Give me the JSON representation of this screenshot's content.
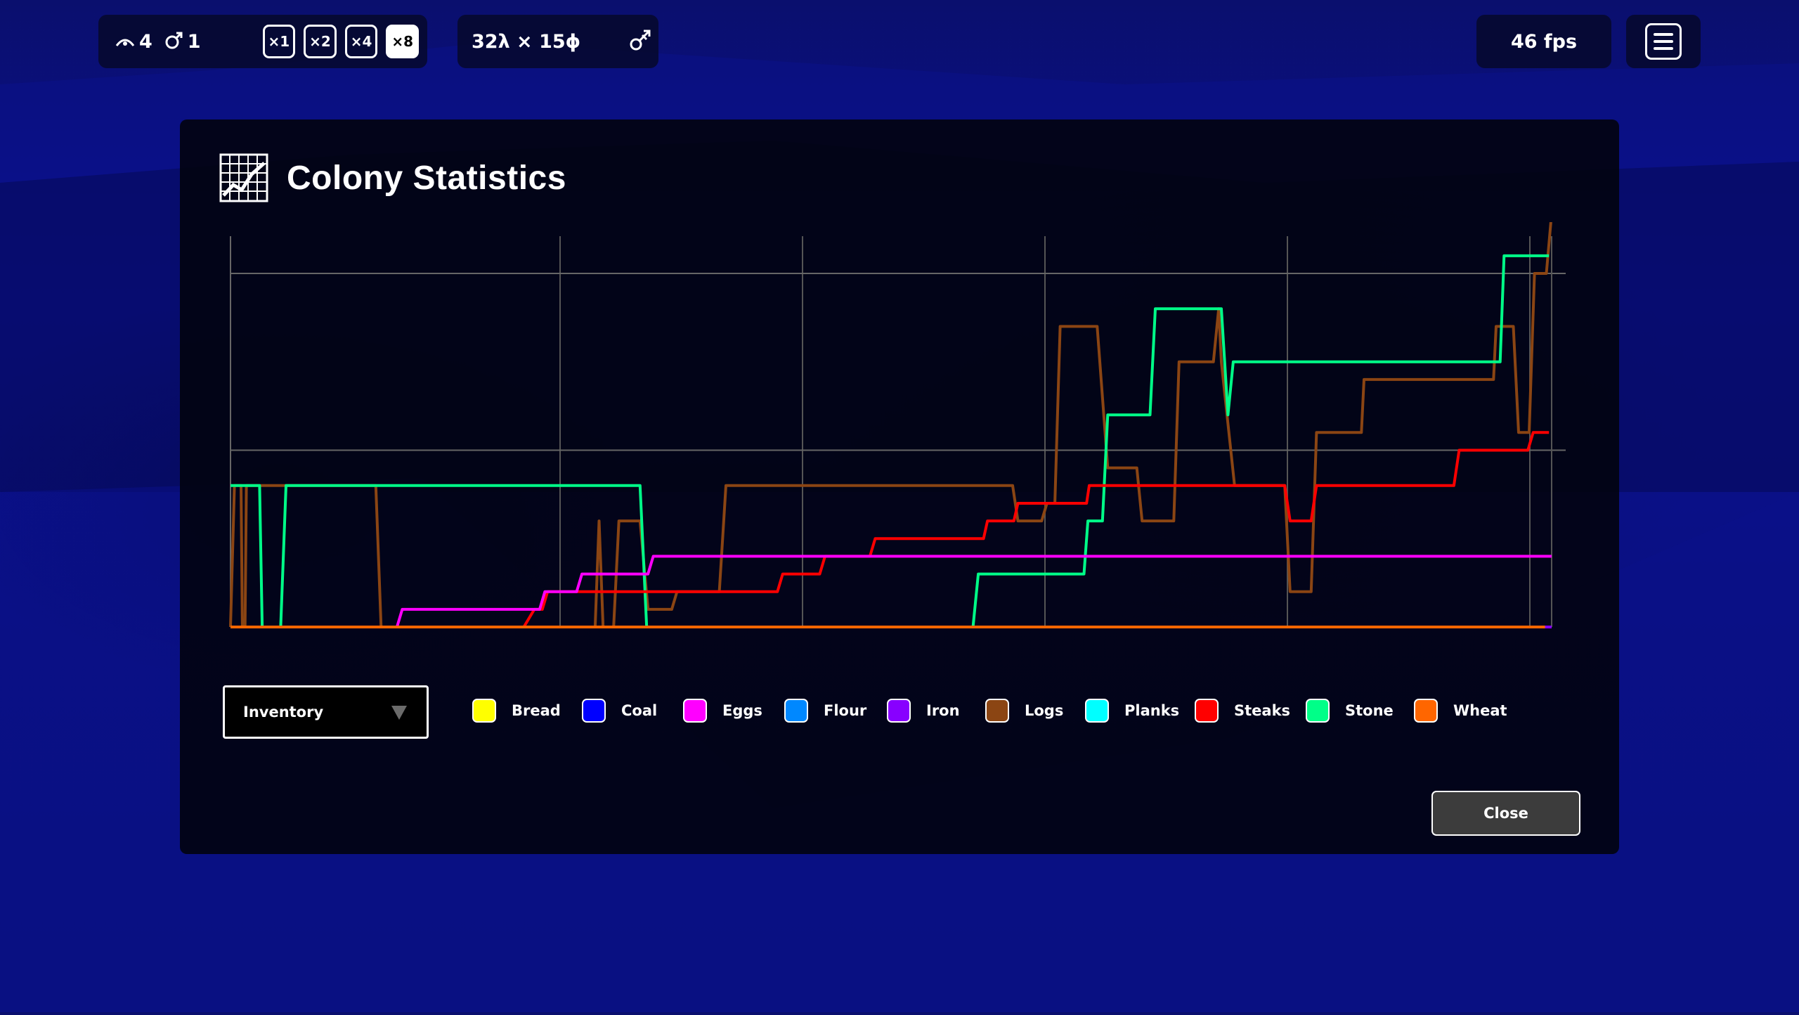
{
  "hud": {
    "colonists_count": "4",
    "males_count": "1",
    "speed_buttons": [
      "×1",
      "×2",
      "×4",
      "×8"
    ],
    "active_speed": "×8",
    "map_size": "32λ × 15ϕ",
    "fps": "46 fps"
  },
  "window": {
    "title": "Colony Statistics",
    "dropdown_value": "Inventory",
    "close_label": "Close"
  },
  "legend": [
    {
      "name": "Bread",
      "color": "#ffff00"
    },
    {
      "name": "Coal",
      "color": "#0000ff"
    },
    {
      "name": "Eggs",
      "color": "#ff00ff"
    },
    {
      "name": "Flour",
      "color": "#0088ff"
    },
    {
      "name": "Iron",
      "color": "#8800ff"
    },
    {
      "name": "Logs",
      "color": "#8b4513"
    },
    {
      "name": "Planks",
      "color": "#00ffff"
    },
    {
      "name": "Steaks",
      "color": "#ff0000"
    },
    {
      "name": "Stone",
      "color": "#00ff88"
    },
    {
      "name": "Wheat",
      "color": "#ff6600"
    }
  ],
  "chart_data": {
    "type": "line",
    "title": "",
    "xlabel": "",
    "ylabel": "",
    "xlim": [
      0,
      100
    ],
    "ylim": [
      0,
      100
    ],
    "grid": true,
    "series": [
      {
        "name": "Logs",
        "color": "#8b4513",
        "points": [
          [
            0,
            0
          ],
          [
            0.3,
            40
          ],
          [
            0.8,
            40
          ],
          [
            0.9,
            0
          ],
          [
            1.1,
            0
          ],
          [
            1.2,
            40
          ],
          [
            11,
            40
          ],
          [
            11.4,
            0
          ],
          [
            27.6,
            0
          ],
          [
            27.9,
            30
          ],
          [
            28.2,
            0
          ],
          [
            29,
            0
          ],
          [
            29.4,
            30
          ],
          [
            31,
            30
          ],
          [
            31.6,
            5
          ],
          [
            33.4,
            5
          ],
          [
            33.8,
            10
          ],
          [
            37,
            10
          ],
          [
            37.5,
            40
          ],
          [
            59.2,
            40
          ],
          [
            59.6,
            30
          ],
          [
            61.4,
            30
          ],
          [
            61.8,
            35
          ],
          [
            62.4,
            35
          ],
          [
            62.8,
            85
          ],
          [
            65.6,
            85
          ],
          [
            66.4,
            45
          ],
          [
            68.6,
            45
          ],
          [
            69,
            30
          ],
          [
            71.4,
            30
          ],
          [
            71.8,
            75
          ],
          [
            74.4,
            75
          ],
          [
            74.8,
            90
          ],
          [
            75,
            75
          ],
          [
            76,
            40
          ],
          [
            79.8,
            40
          ],
          [
            80.2,
            10
          ],
          [
            81.8,
            10
          ],
          [
            82.2,
            55
          ],
          [
            85.6,
            55
          ],
          [
            85.8,
            70
          ],
          [
            95.6,
            70
          ],
          [
            95.8,
            85
          ],
          [
            97.1,
            85
          ],
          [
            97.5,
            55
          ],
          [
            98.3,
            55
          ],
          [
            98.7,
            100
          ],
          [
            99.6,
            100
          ],
          [
            100,
            117
          ]
        ]
      },
      {
        "name": "Stone",
        "color": "#00ff88",
        "points": [
          [
            0,
            40
          ],
          [
            2.2,
            40
          ],
          [
            2.4,
            0
          ],
          [
            3.8,
            0
          ],
          [
            4.2,
            40
          ],
          [
            31,
            40
          ],
          [
            31.5,
            0
          ],
          [
            56.2,
            0
          ],
          [
            56.6,
            15
          ],
          [
            64.6,
            15
          ],
          [
            64.9,
            30
          ],
          [
            66,
            30
          ],
          [
            66.4,
            60
          ],
          [
            69.6,
            60
          ],
          [
            70,
            90
          ],
          [
            75,
            90
          ],
          [
            75.5,
            60
          ],
          [
            75.9,
            75
          ],
          [
            96.1,
            75
          ],
          [
            96.4,
            105
          ],
          [
            99.8,
            105
          ]
        ]
      },
      {
        "name": "Steaks",
        "color": "#ff0000",
        "points": [
          [
            22.2,
            0
          ],
          [
            23,
            5
          ],
          [
            23.6,
            5
          ],
          [
            24,
            10
          ],
          [
            41.4,
            10
          ],
          [
            41.8,
            15
          ],
          [
            44.6,
            15
          ],
          [
            45,
            20
          ],
          [
            48.4,
            20
          ],
          [
            48.8,
            25
          ],
          [
            57,
            25
          ],
          [
            57.3,
            30
          ],
          [
            59.3,
            30
          ],
          [
            59.6,
            35
          ],
          [
            64.8,
            35
          ],
          [
            65,
            40
          ],
          [
            79.8,
            40
          ],
          [
            80.2,
            30
          ],
          [
            81.8,
            30
          ],
          [
            82.2,
            40
          ],
          [
            92.6,
            40
          ],
          [
            93,
            50
          ],
          [
            98.2,
            50
          ],
          [
            98.6,
            55
          ],
          [
            99.8,
            55
          ]
        ]
      },
      {
        "name": "Eggs",
        "color": "#ff00ff",
        "points": [
          [
            12.6,
            0
          ],
          [
            13,
            5
          ],
          [
            23.4,
            5
          ],
          [
            23.8,
            10
          ],
          [
            26.2,
            10
          ],
          [
            26.6,
            15
          ],
          [
            31.6,
            15
          ],
          [
            32,
            20
          ],
          [
            100,
            20
          ]
        ]
      },
      {
        "name": "Wheat",
        "color": "#ff6600",
        "points": [
          [
            0,
            0
          ],
          [
            100,
            0
          ]
        ]
      },
      {
        "name": "Iron",
        "color": "#8800ff",
        "points": [
          [
            99.5,
            0
          ],
          [
            100,
            0
          ]
        ]
      }
    ]
  }
}
